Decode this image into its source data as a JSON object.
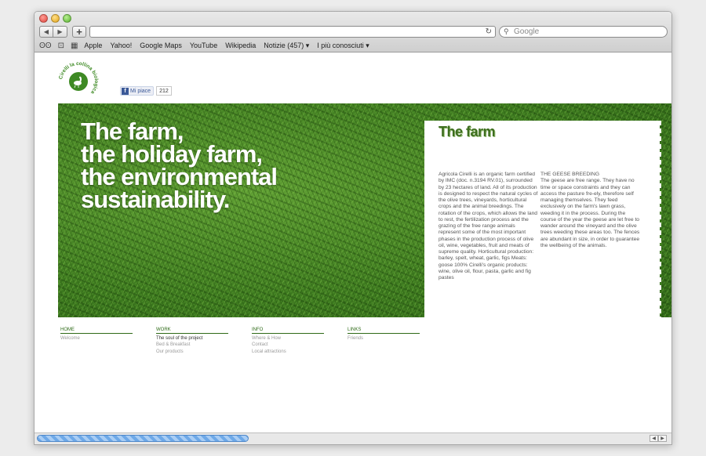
{
  "browser": {
    "search_placeholder": "Google",
    "bookmarks": [
      "Apple",
      "Yahoo!",
      "Google Maps",
      "YouTube",
      "Wikipedia",
      "Notizie (457) ▾",
      "I più conosciuti ▾"
    ]
  },
  "logo": {
    "text": "Cirelli la collina biologica"
  },
  "facebook": {
    "like_label": "Mi piace",
    "count": "212"
  },
  "hero": {
    "headline_lines": [
      "The farm,",
      "the holiday farm,",
      "the environmental",
      "sustainability."
    ]
  },
  "panel": {
    "title": "The farm",
    "left_text": "Agricola Cirelli is an organic farm certified by IMC (doc. n.3194 RV.01), surrounded by 23 hectares of land. All of its production is designed to respect the natural cycles of the olive trees, vineyards, horticultural crops and the animal breedings. The rotation of the crops, which allows the land to rest, the fertilization process and the grazing of the free range animals represent some of the most important phases in the production process of olive oil, wine, vegetables, fruit and meats of supreme quality. Horticultural production: barley, spelt, wheat, garlic, figs Meats: goose 100% Cirelli's organic products: wine, olive oil, flour, pasta, garlic and fig pastes",
    "right_heading": "THE GEESE BREEDING",
    "right_text": "The geese are free range. They have no time or space constraints and they can access the pasture fre-ely, therefore self managing themselves. They feed exclusively on the farm's lawn grass, weeding it in the process. During the course of the year the geese are let free to wander around the vineyard and the olive trees weeding these areas too. The fences are abundant in size, in order to guarantee the wellbeing of the animals."
  },
  "footer_nav": [
    {
      "heading": "HOME",
      "links": [
        "Welcome"
      ]
    },
    {
      "heading": "WORK",
      "links": [
        "The soul of the project",
        "Bed & Breakfast",
        "Our products"
      ]
    },
    {
      "heading": "INFO",
      "links": [
        "Where & How",
        "Contact",
        "Local attractions"
      ]
    },
    {
      "heading": "LINKS",
      "links": [
        "Friends"
      ]
    }
  ],
  "colors": {
    "brand_green": "#2e6a17",
    "title_green": "#3e6e1f"
  },
  "icons": [
    "back-arrow-icon",
    "forward-arrow-icon",
    "plus-icon",
    "reload-icon",
    "magnifier-icon",
    "reading-glasses-icon",
    "open-book-icon",
    "grid-icon",
    "goose-icon",
    "facebook-icon"
  ]
}
